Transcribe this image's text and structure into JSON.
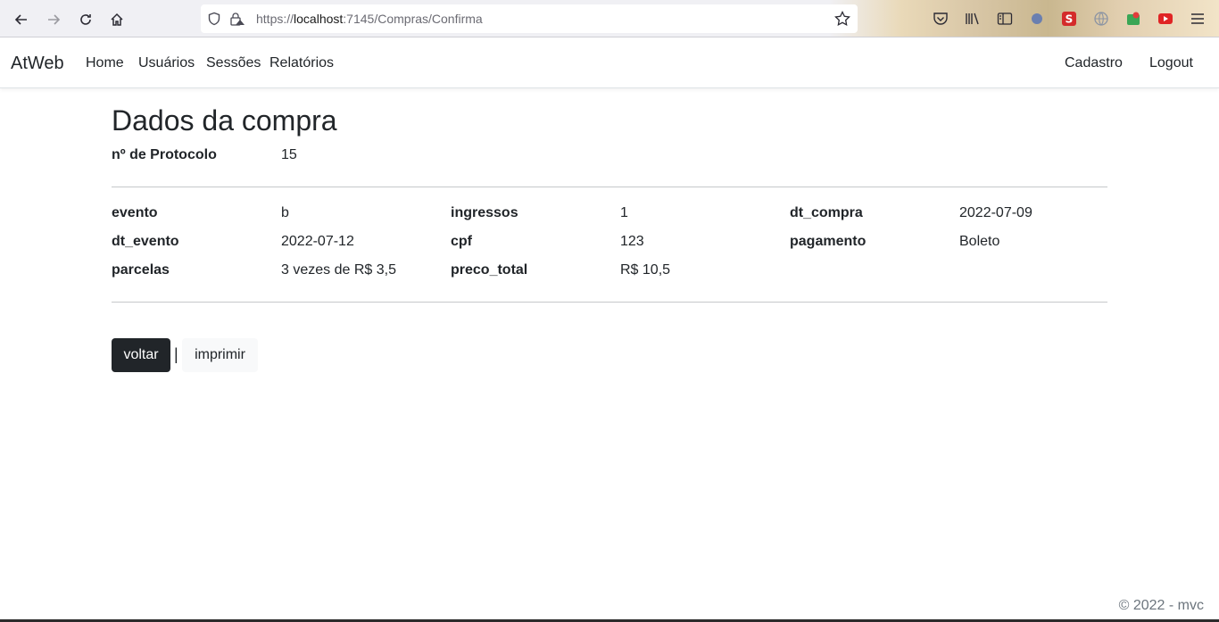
{
  "browser": {
    "url_prefix": "https://",
    "url_host": "localhost",
    "url_path": ":7145/Compras/Confirma"
  },
  "navbar": {
    "brand": "AtWeb",
    "links": [
      "Home",
      "Usuários",
      "Sessões",
      "Relatórios"
    ],
    "right_links": [
      "Cadastro",
      "Logout"
    ]
  },
  "main": {
    "title": "Dados da compra",
    "protocol": {
      "label": "nº de Protocolo",
      "value": "15"
    },
    "fields": {
      "evento": {
        "label": "evento",
        "value": "b"
      },
      "ingressos": {
        "label": "ingressos",
        "value": "1"
      },
      "dt_compra": {
        "label": "dt_compra",
        "value": "2022-07-09"
      },
      "dt_evento": {
        "label": "dt_evento",
        "value": "2022-07-12"
      },
      "cpf": {
        "label": "cpf",
        "value": "123"
      },
      "pagamento": {
        "label": "pagamento",
        "value": "Boleto"
      },
      "parcelas": {
        "label": "parcelas",
        "value": "3 vezes de R$ 3,5"
      },
      "preco_total": {
        "label": "preco_total",
        "value": "R$ 10,5"
      }
    },
    "actions": {
      "voltar": "voltar",
      "separator": "|",
      "imprimir": "imprimir"
    }
  },
  "footer": {
    "text": "© 2022 - mvc"
  },
  "colors": {
    "primary_dark": "#212529",
    "light_button": "#f8f9fa",
    "muted": "#6c757d"
  }
}
